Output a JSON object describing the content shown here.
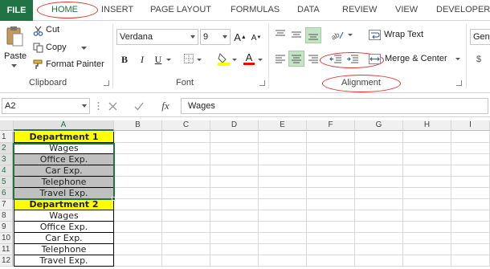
{
  "tabs": [
    "FILE",
    "HOME",
    "INSERT",
    "PAGE LAYOUT",
    "FORMULAS",
    "DATA",
    "REVIEW",
    "VIEW",
    "DEVELOPER"
  ],
  "clipboard": {
    "paste": "Paste",
    "cut": "Cut",
    "copy": "Copy",
    "format_painter": "Format Painter",
    "label": "Clipboard"
  },
  "font": {
    "name": "Verdana",
    "size": "9",
    "bold": "B",
    "italic": "I",
    "underline": "U",
    "label": "Font"
  },
  "alignment": {
    "wrap_text": "Wrap Text",
    "merge_center": "Merge & Center",
    "label": "Alignment"
  },
  "number": {
    "format": "Gen"
  },
  "formula_bar": {
    "name_box": "A2",
    "fx": "fx",
    "value": "Wages"
  },
  "columns": [
    "A",
    "B",
    "C",
    "D",
    "E",
    "F",
    "G",
    "H",
    "I"
  ],
  "rows": [
    {
      "num": "1",
      "value": "Department 1",
      "style": "header"
    },
    {
      "num": "2",
      "value": "Wages",
      "style": "plain"
    },
    {
      "num": "3",
      "value": "Office Exp.",
      "style": "gray"
    },
    {
      "num": "4",
      "value": "Car Exp.",
      "style": "gray"
    },
    {
      "num": "5",
      "value": "Telephone",
      "style": "gray"
    },
    {
      "num": "6",
      "value": "Travel Exp.",
      "style": "gray"
    },
    {
      "num": "7",
      "value": "Department 2",
      "style": "header"
    },
    {
      "num": "8",
      "value": "Wages",
      "style": "plain"
    },
    {
      "num": "9",
      "value": "Office Exp.",
      "style": "plain"
    },
    {
      "num": "10",
      "value": "Car Exp.",
      "style": "plain"
    },
    {
      "num": "11",
      "value": "Telephone",
      "style": "plain"
    },
    {
      "num": "12",
      "value": "Travel Exp.",
      "style": "plain"
    }
  ],
  "colors": {
    "accent": "#217346",
    "highlight_yellow": "#ffff00",
    "gray_fill": "#c0c0c0",
    "annotation_red": "#e03030",
    "font_color_bar": "#ff0000",
    "fill_color_bar": "#ffff00"
  }
}
